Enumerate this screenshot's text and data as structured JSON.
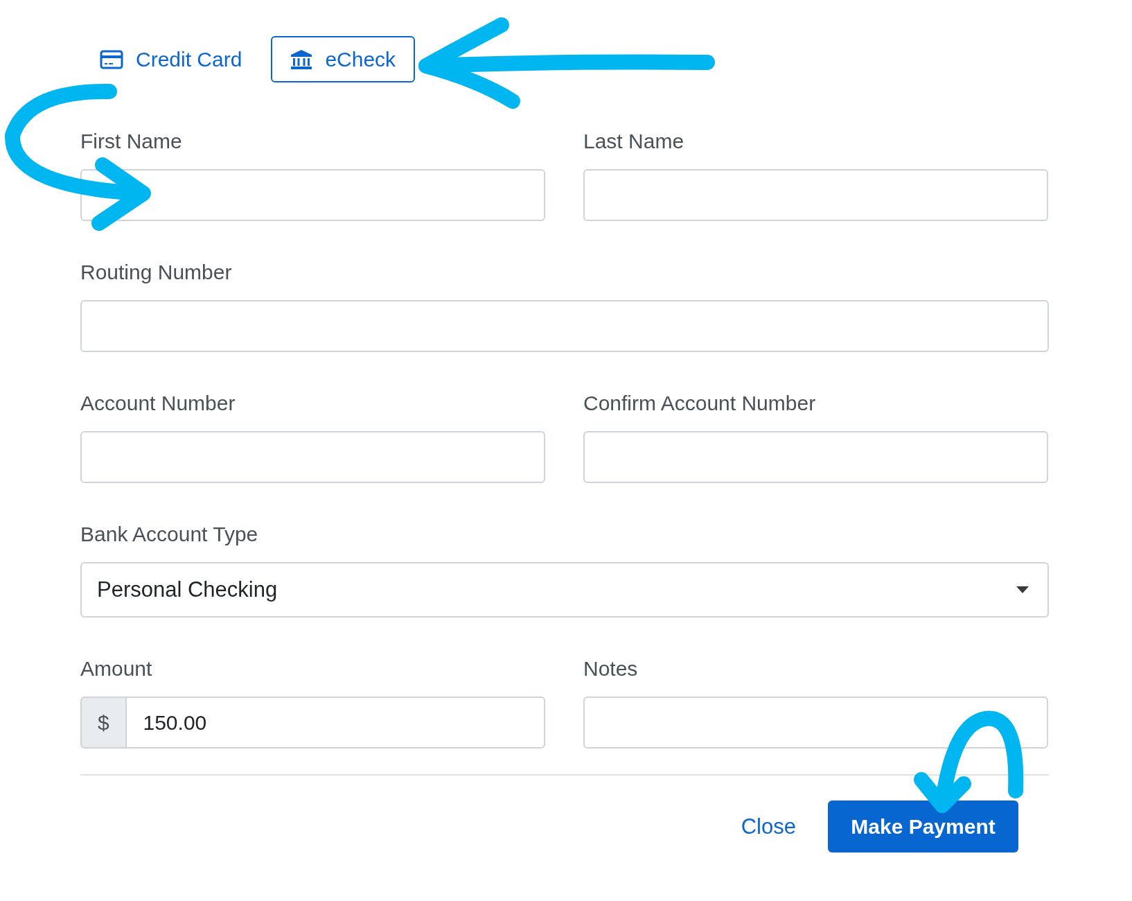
{
  "tabs": [
    {
      "label": "Credit Card",
      "kind": "card",
      "selected": false
    },
    {
      "label": "eCheck",
      "kind": "bank",
      "selected": true
    }
  ],
  "rows": [
    {
      "fields": [
        {
          "kind": "text",
          "label": "First Name"
        },
        {
          "kind": "text",
          "label": "Last Name"
        }
      ]
    },
    {
      "fields": [
        {
          "kind": "text",
          "label": "Routing Number"
        }
      ]
    },
    {
      "fields": [
        {
          "kind": "text",
          "label": "Account Number"
        },
        {
          "kind": "text",
          "label": "Confirm Account Number"
        }
      ]
    },
    {
      "fields": [
        {
          "kind": "select",
          "label": "Bank Account Type",
          "value": "Personal Checking"
        }
      ]
    },
    {
      "fields": [
        {
          "kind": "currency",
          "label": "Amount",
          "prefix": "$",
          "value": "150.00"
        },
        {
          "kind": "text",
          "label": "Notes"
        }
      ]
    }
  ],
  "buttons": [
    {
      "kind": "link",
      "label": "Close"
    },
    {
      "kind": "primary",
      "label": "Make Payment"
    }
  ]
}
